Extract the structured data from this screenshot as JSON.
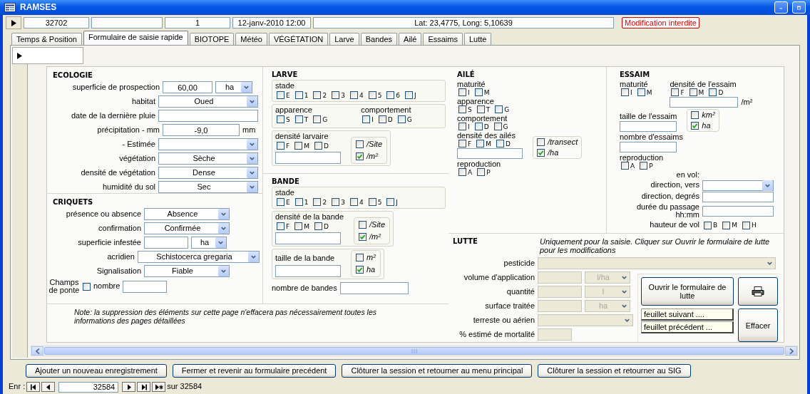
{
  "window": {
    "title": "RAMSES"
  },
  "record": {
    "id": "32702",
    "number": "1",
    "date": "12-janv-2010 12:00",
    "position": "Lat: 23,4775, Long: 5,10639",
    "notice": "Modification interdite"
  },
  "tabs": [
    {
      "label": "Temps & Position",
      "selected": false
    },
    {
      "label": "Formulaire de saisie rapide",
      "selected": true
    },
    {
      "label": "BIOTOPE",
      "selected": false
    },
    {
      "label": "Météo",
      "selected": false
    },
    {
      "label": "VÉGÉTATION",
      "selected": false
    },
    {
      "label": "Larve",
      "selected": false
    },
    {
      "label": "Bandes",
      "selected": false
    },
    {
      "label": "Ailé",
      "selected": false
    },
    {
      "label": "Essaims",
      "selected": false
    },
    {
      "label": "Lutte",
      "selected": false
    }
  ],
  "ecologie": {
    "title": "ECOLOGIE",
    "fields": [
      {
        "label": "superficie de prospection",
        "controls": [
          {
            "kind": "text",
            "value": "60,00"
          },
          {
            "kind": "select",
            "value": "ha"
          }
        ]
      },
      {
        "label": "habitat",
        "controls": [
          {
            "kind": "select",
            "value": "Oued"
          }
        ]
      },
      {
        "label": "date de la dernière pluie",
        "controls": [
          {
            "kind": "text"
          }
        ]
      },
      {
        "label": "précipitation - mm",
        "controls": [
          {
            "kind": "text",
            "value": "-9,0"
          },
          {
            "kind": "suffix",
            "value": "mm"
          }
        ]
      },
      {
        "label": "- Estimée",
        "controls": [
          {
            "kind": "select"
          }
        ]
      },
      {
        "label": "végétation",
        "controls": [
          {
            "kind": "select",
            "value": "Sèche"
          }
        ]
      },
      {
        "label": "densité de végétation",
        "controls": [
          {
            "kind": "select",
            "value": "Dense"
          }
        ]
      },
      {
        "label": "humidité du sol",
        "controls": [
          {
            "kind": "select",
            "value": "Sec"
          }
        ]
      }
    ]
  },
  "criquets": {
    "title": "CRIQUETS",
    "fields": [
      {
        "label": "présence ou absence",
        "controls": [
          {
            "kind": "select",
            "value": "Absence"
          }
        ]
      },
      {
        "label": "confirmation",
        "controls": [
          {
            "kind": "select",
            "value": "Confirmée"
          }
        ]
      },
      {
        "label": "superficie infestée",
        "controls": [
          {
            "kind": "text"
          },
          {
            "kind": "select",
            "value": "ha"
          }
        ]
      },
      {
        "label": "acridien",
        "controls": [
          {
            "kind": "select",
            "value": "Schistocerca gregaria"
          }
        ]
      },
      {
        "label": "Signalisation",
        "controls": [
          {
            "kind": "select",
            "value": "Fiable"
          }
        ]
      },
      {
        "label": "Champs de ponte",
        "controls": [
          {
            "kind": "checkbox",
            "checked": false
          },
          {
            "kind": "suffix",
            "value": "nombre"
          },
          {
            "kind": "text"
          }
        ]
      }
    ]
  },
  "larve": {
    "title": "LARVE",
    "framed": true,
    "blocks": [
      {
        "kind": "checks",
        "label": "stade",
        "options": [
          {
            "label": "E",
            "checked": false
          },
          {
            "label": "1",
            "checked": false
          },
          {
            "label": "2",
            "checked": false
          },
          {
            "label": "3",
            "checked": false
          },
          {
            "label": "4",
            "checked": false
          },
          {
            "label": "5",
            "checked": false
          },
          {
            "label": "6",
            "checked": false
          },
          {
            "label": "J",
            "checked": false
          }
        ]
      },
      {
        "kind": "pair",
        "items": [
          {
            "kind": "checks",
            "label": "apparence",
            "options": [
              {
                "label": "S",
                "checked": false
              },
              {
                "label": "T",
                "checked": false
              },
              {
                "label": "G",
                "checked": false
              }
            ]
          },
          {
            "kind": "checks",
            "label": "comportement",
            "options": [
              {
                "label": "I",
                "checked": false
              },
              {
                "label": "D",
                "checked": false
              },
              {
                "label": "G",
                "checked": false
              }
            ]
          }
        ]
      },
      {
        "kind": "measure",
        "label": "densité larvaire",
        "options": [
          {
            "label": "F",
            "checked": false
          },
          {
            "label": "M",
            "checked": false
          },
          {
            "label": "D",
            "checked": false
          }
        ],
        "units": [
          {
            "label": "/Site",
            "checked": false
          },
          {
            "label": "/m²",
            "checked": true
          }
        ]
      }
    ]
  },
  "bande": {
    "title": "BANDE",
    "framed": true,
    "blocks": [
      {
        "kind": "checks",
        "label": "stade",
        "options": [
          {
            "label": "E",
            "checked": false
          },
          {
            "label": "1",
            "checked": false
          },
          {
            "label": "2",
            "checked": false
          },
          {
            "label": "3",
            "checked": false
          },
          {
            "label": "4",
            "checked": false
          },
          {
            "label": "5",
            "checked": false
          },
          {
            "label": "J",
            "checked": false
          }
        ]
      },
      {
        "kind": "measure",
        "label": "densité de la bande",
        "options": [
          {
            "label": "F",
            "checked": false
          },
          {
            "label": "M",
            "checked": false
          },
          {
            "label": "D",
            "checked": false
          }
        ],
        "units": [
          {
            "label": "/Site",
            "checked": false
          },
          {
            "label": "/m²",
            "checked": true
          }
        ]
      },
      {
        "kind": "measure",
        "label": "taille de la bande",
        "units": [
          {
            "label": "m²",
            "checked": false
          },
          {
            "label": "ha",
            "checked": true
          }
        ]
      },
      {
        "kind": "field",
        "label": "nombre de bandes",
        "controls": [
          {
            "kind": "text"
          }
        ]
      }
    ]
  },
  "aile": {
    "title": "AILÉ",
    "framed": false,
    "blocks": [
      {
        "kind": "checks",
        "label": "maturité",
        "options": [
          {
            "label": "I",
            "checked": false
          },
          {
            "label": "M",
            "checked": false
          }
        ]
      },
      {
        "kind": "checks",
        "label": "apparence",
        "options": [
          {
            "label": "S",
            "checked": false
          },
          {
            "label": "T",
            "checked": false
          },
          {
            "label": "G",
            "checked": false
          }
        ]
      },
      {
        "kind": "checks",
        "label": "comportement",
        "options": [
          {
            "label": "I",
            "checked": false
          },
          {
            "label": "D",
            "checked": false
          },
          {
            "label": "G",
            "checked": false
          }
        ]
      },
      {
        "kind": "measure",
        "label": "densité des ailés",
        "options": [
          {
            "label": "F",
            "checked": false
          },
          {
            "label": "M",
            "checked": false
          },
          {
            "label": "D",
            "checked": false
          }
        ],
        "units": [
          {
            "label": "/transect",
            "checked": false
          },
          {
            "label": "/ha",
            "checked": true
          }
        ]
      },
      {
        "kind": "checks",
        "label": "reproduction",
        "options": [
          {
            "label": "A",
            "checked": false
          },
          {
            "label": "P",
            "checked": false
          }
        ]
      }
    ]
  },
  "essaim": {
    "title": "ESSAIM",
    "framed": false,
    "blocks": [
      {
        "kind": "pair",
        "items": [
          {
            "kind": "checks",
            "label": "maturité",
            "options": [
              {
                "label": "I",
                "checked": false
              },
              {
                "label": "M",
                "checked": false
              }
            ]
          },
          {
            "kind": "measure",
            "label": "densité de l'essaim",
            "options": [
              {
                "label": "F",
                "checked": false
              },
              {
                "label": "M",
                "checked": false
              },
              {
                "label": "D",
                "checked": false
              }
            ],
            "suffix": "/m²"
          }
        ]
      },
      {
        "kind": "measure",
        "label": "taille de l'essaim",
        "units": [
          {
            "label": "km²",
            "checked": false
          },
          {
            "label": "ha",
            "checked": true
          }
        ]
      },
      {
        "kind": "measure",
        "label": "nombre d'essaims"
      },
      {
        "kind": "checks",
        "label": "reproduction",
        "options": [
          {
            "label": "A",
            "checked": false
          },
          {
            "label": "P",
            "checked": false
          }
        ]
      },
      {
        "kind": "caption",
        "label": "en vol:"
      },
      {
        "kind": "field",
        "label": "direction, vers",
        "controls": [
          {
            "kind": "select"
          }
        ]
      },
      {
        "kind": "field",
        "label": "direction, degrés",
        "controls": [
          {
            "kind": "text"
          }
        ]
      },
      {
        "kind": "field",
        "label": "durée du passage hh:mm",
        "controls": [
          {
            "kind": "text"
          }
        ]
      },
      {
        "kind": "inline_checks",
        "label": "hauteur de vol",
        "options": [
          {
            "label": "B",
            "checked": false
          },
          {
            "label": "M",
            "checked": false
          },
          {
            "label": "H",
            "checked": false
          }
        ]
      }
    ]
  },
  "note": "Note: la suppression des éléments sur cette page n'effacera pas nécessairement toutes les informations des pages détaillées",
  "lutte": {
    "title": "LUTTE",
    "hint": "Uniquement pour la saisie. Cliquer sur Ouvrir le formulaire de lutte pour les modifications",
    "fields": [
      {
        "label": "pesticide",
        "disabled": true,
        "controls": [
          {
            "kind": "select"
          }
        ]
      },
      {
        "label": "volume d'application",
        "disabled": true,
        "controls": [
          {
            "kind": "text"
          },
          {
            "kind": "select",
            "value": "l/ha"
          }
        ]
      },
      {
        "label": "quantité",
        "disabled": true,
        "controls": [
          {
            "kind": "text"
          },
          {
            "kind": "select",
            "value": "l"
          }
        ]
      },
      {
        "label": "surface traitée",
        "disabled": true,
        "controls": [
          {
            "kind": "text"
          },
          {
            "kind": "select",
            "value": "ha"
          }
        ]
      },
      {
        "label": "terreste ou aérien",
        "disabled": true,
        "controls": [
          {
            "kind": "select"
          }
        ]
      },
      {
        "label": "% estimé de mortalité",
        "disabled": true,
        "controls": [
          {
            "kind": "text"
          }
        ]
      }
    ],
    "open_button": "Ouvrir le formulaire de lutte",
    "sheet_buttons": [
      "feuillet suivant ....",
      "feuillet précédent ..."
    ],
    "clear_button": "Effacer"
  },
  "actions": [
    "Ajouter un nouveau enregistrement",
    "Fermer et revenir au formulaire precédent",
    "Clôturer la session et retourner au menu principal",
    "Clôturer la session et retourner au SIG"
  ],
  "navigator": {
    "label": "Enr :",
    "current": "32584",
    "total": "sur 32584"
  }
}
